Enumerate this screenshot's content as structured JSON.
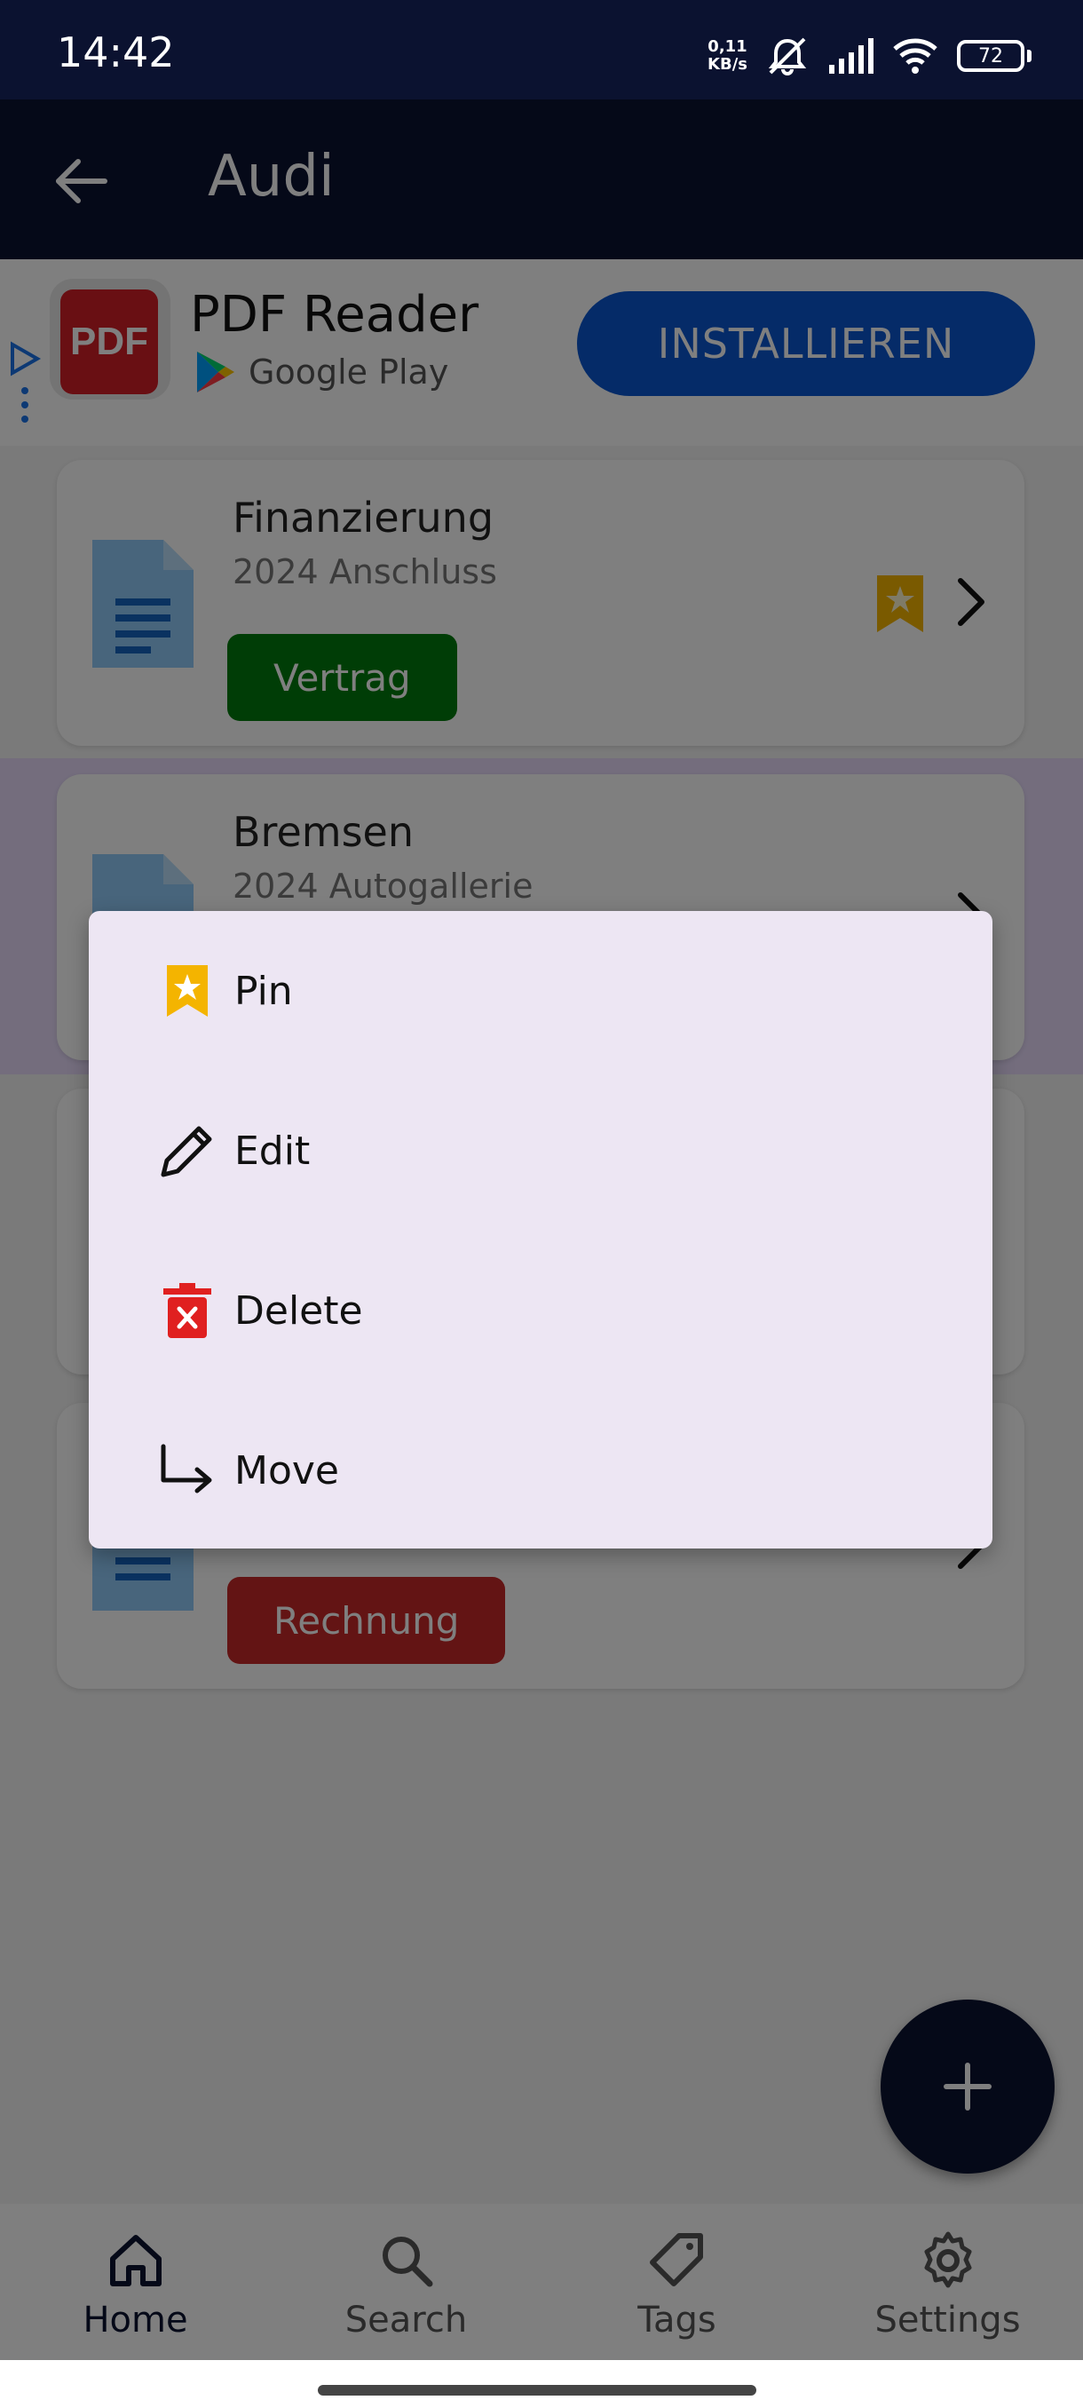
{
  "status_bar": {
    "time": "14:42",
    "net_speed_value": "0,11",
    "net_speed_unit": "KB/s",
    "battery": "72",
    "icons": [
      "silent-icon",
      "signal-icon",
      "wifi-icon",
      "battery-icon"
    ]
  },
  "app_bar": {
    "title": "Audi",
    "back_icon": "arrow-left-icon"
  },
  "ad": {
    "app_icon_text": "PDF",
    "title": "PDF Reader",
    "store": "Google Play",
    "install_label": "INSTALLIEREN"
  },
  "documents": [
    {
      "title": "Finanzierung",
      "subtitle": "2024 Anschluss",
      "tag": "Vertrag",
      "tag_color": "#007a0c",
      "pinned": true
    },
    {
      "title": "Bremsen",
      "subtitle": "2024 Autogallerie",
      "tag": "",
      "pinned": false
    },
    {
      "title": "",
      "subtitle": "",
      "tag": "",
      "pinned": false
    },
    {
      "title": "",
      "subtitle": "",
      "tag": "Rechnung",
      "tag_color": "#c62828",
      "pinned": false
    }
  ],
  "context_menu": {
    "items": [
      {
        "label": "Pin",
        "icon": "bookmark-star-icon"
      },
      {
        "label": "Edit",
        "icon": "pencil-icon"
      },
      {
        "label": "Delete",
        "icon": "trash-icon"
      },
      {
        "label": "Move",
        "icon": "move-arrow-icon"
      }
    ]
  },
  "fab": {
    "icon": "plus-icon"
  },
  "bottom_nav": {
    "items": [
      {
        "label": "Home",
        "icon": "home-icon",
        "active": true
      },
      {
        "label": "Search",
        "icon": "search-icon",
        "active": false
      },
      {
        "label": "Tags",
        "icon": "tag-icon",
        "active": false
      },
      {
        "label": "Settings",
        "icon": "gear-icon",
        "active": false
      }
    ]
  },
  "colors": {
    "primary_dark": "#0b1230",
    "install_blue": "#0b57d0",
    "pin_gold": "#f4b400",
    "delete_red": "#e02020",
    "menu_bg": "#ede6f3",
    "highlight_row": "#e8dbfb"
  }
}
